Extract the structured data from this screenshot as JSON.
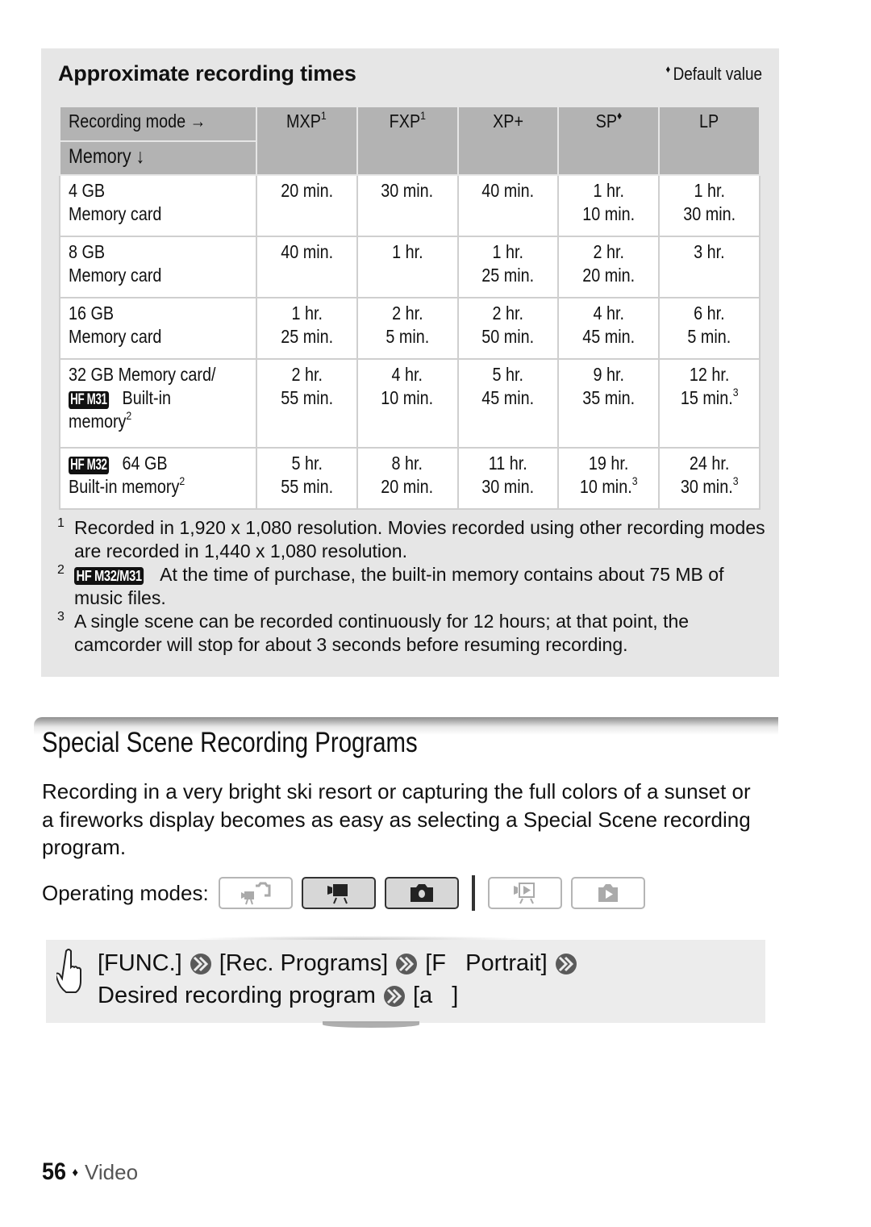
{
  "recording_times": {
    "title": "Approximate recording times",
    "default_marker": "♦",
    "default_label": "Default value",
    "header": {
      "corner_top": "Recording mode →",
      "corner_bottom": "Memory ↓",
      "modes": [
        {
          "label": "MXP",
          "sup": "1"
        },
        {
          "label": "FXP",
          "sup": "1"
        },
        {
          "label": "XP+",
          "sup": ""
        },
        {
          "label": "SP",
          "sup": "♦"
        },
        {
          "label": "LP",
          "sup": ""
        }
      ]
    },
    "rows": [
      {
        "memory_line1": "4 GB",
        "memory_line2": "Memory card",
        "badge": "",
        "memory_sup": "",
        "cells": [
          {
            "l1": "20 min.",
            "l2": "",
            "sup": ""
          },
          {
            "l1": "30 min.",
            "l2": "",
            "sup": ""
          },
          {
            "l1": "40 min.",
            "l2": "",
            "sup": ""
          },
          {
            "l1": "1 hr.",
            "l2": "10 min.",
            "sup": ""
          },
          {
            "l1": "1 hr.",
            "l2": "30 min.",
            "sup": ""
          }
        ]
      },
      {
        "memory_line1": "8 GB",
        "memory_line2": "Memory card",
        "badge": "",
        "memory_sup": "",
        "cells": [
          {
            "l1": "40 min.",
            "l2": "",
            "sup": ""
          },
          {
            "l1": "1 hr.",
            "l2": "",
            "sup": ""
          },
          {
            "l1": "1 hr.",
            "l2": "25 min.",
            "sup": ""
          },
          {
            "l1": "2 hr.",
            "l2": "20 min.",
            "sup": ""
          },
          {
            "l1": "3 hr.",
            "l2": "",
            "sup": ""
          }
        ]
      },
      {
        "memory_line1": "16 GB",
        "memory_line2": "Memory card",
        "badge": "",
        "memory_sup": "",
        "cells": [
          {
            "l1": "1 hr.",
            "l2": "25 min.",
            "sup": ""
          },
          {
            "l1": "2 hr.",
            "l2": "5 min.",
            "sup": ""
          },
          {
            "l1": "2 hr.",
            "l2": "50 min.",
            "sup": ""
          },
          {
            "l1": "4 hr.",
            "l2": "45 min.",
            "sup": ""
          },
          {
            "l1": "6 hr.",
            "l2": "5 min.",
            "sup": ""
          }
        ]
      },
      {
        "memory_line1": "32 GB Memory card/",
        "badge": "HF M31",
        "memory_line2": "Built-in",
        "memory_line3": "memory",
        "memory_sup": "2",
        "cells": [
          {
            "l1": "2 hr.",
            "l2": "55 min.",
            "sup": ""
          },
          {
            "l1": "4 hr.",
            "l2": "10 min.",
            "sup": ""
          },
          {
            "l1": "5 hr.",
            "l2": "45 min.",
            "sup": ""
          },
          {
            "l1": "9 hr.",
            "l2": "35 min.",
            "sup": ""
          },
          {
            "l1": "12 hr.",
            "l2": "15 min.",
            "sup": "3"
          }
        ]
      },
      {
        "badge": "HF M32",
        "memory_line1": "64 GB",
        "memory_line2": "Built-in memory",
        "memory_sup": "2",
        "cells": [
          {
            "l1": "5 hr.",
            "l2": "55 min.",
            "sup": ""
          },
          {
            "l1": "8 hr.",
            "l2": "20 min.",
            "sup": ""
          },
          {
            "l1": "11 hr.",
            "l2": "30 min.",
            "sup": ""
          },
          {
            "l1": "19 hr.",
            "l2": "10 min.",
            "sup": "3"
          },
          {
            "l1": "24 hr.",
            "l2": "30 min.",
            "sup": "3"
          }
        ]
      }
    ],
    "notes": [
      {
        "num": "1",
        "badge": "",
        "text": "Recorded in 1,920 x 1,080 resolution. Movies recorded using other recording modes are recorded in 1,440 x 1,080 resolution."
      },
      {
        "num": "2",
        "badge": "HF M32/M31",
        "text": "At the time of purchase, the built-in memory contains about 75 MB of music files."
      },
      {
        "num": "3",
        "badge": "",
        "text": "A single scene can be recorded continuously for 12 hours; at that point, the camcorder will stop for about 3 seconds before resuming recording."
      }
    ]
  },
  "section": {
    "title": "Special Scene Recording Programs",
    "body": "Recording in a very bright ski resort or capturing the full colors of a sunset or a fireworks display becomes as easy as selecting a Special Scene recording program.",
    "operating_modes_label": "Operating modes:",
    "operating_modes": [
      {
        "icon": "dual-shot-icon",
        "active": false
      },
      {
        "icon": "movie-camera-icon",
        "active": true
      },
      {
        "icon": "photo-camera-icon",
        "active": true
      },
      {
        "icon": "movie-playback-icon",
        "active": false
      },
      {
        "icon": "photo-playback-icon",
        "active": false
      }
    ],
    "procedure": {
      "line1": [
        "[FUNC.]",
        "[Rec. Programs]",
        "[F   Portrait]"
      ],
      "line2": [
        "Desired recording program",
        "[a   ]"
      ]
    }
  },
  "footer": {
    "page_number": "56",
    "separator": "♦",
    "section_name": "Video"
  },
  "colors": {
    "box_background": "#e6e6e6",
    "table_header": "#b3b3b3",
    "accent_dark": "#333333"
  }
}
